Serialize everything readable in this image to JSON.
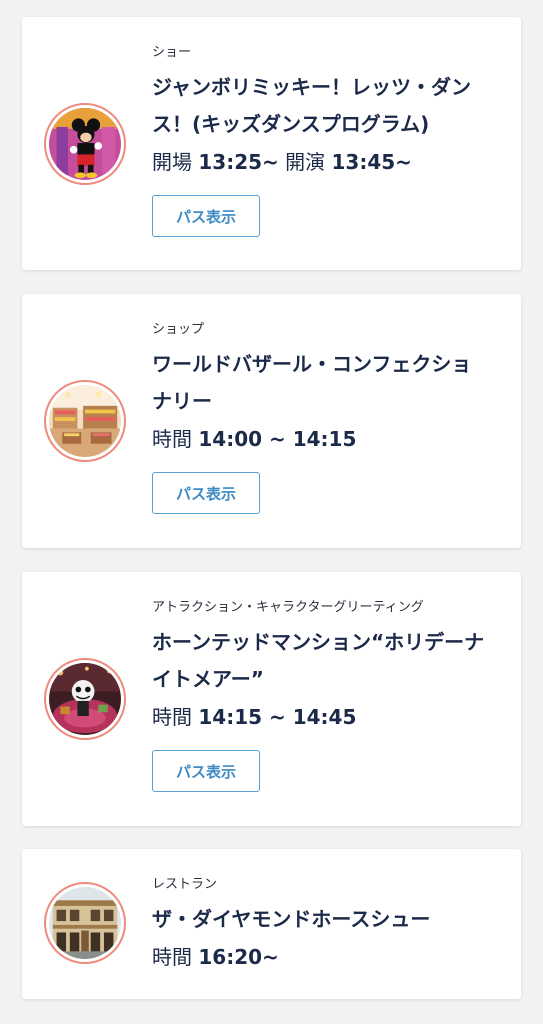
{
  "items": [
    {
      "category": "ショー",
      "title_lines": [
        "ジャンボリミッキー！レッツ・ダン",
        "ス！(キッズダンスプログラム)"
      ],
      "time_label_1": "開場",
      "time_value_1": "13:25~",
      "time_label_2": "開演",
      "time_value_2": "13:45~",
      "button": "パス表示",
      "thumb_icon": "mickey-mouse-photo"
    },
    {
      "category": "ショップ",
      "title_lines": [
        "ワールドバザール・コンフェクショ",
        "ナリー"
      ],
      "time_label_1": "時間",
      "time_value_1": "14:00 ~ 14:15",
      "button": "パス表示",
      "thumb_icon": "shop-interior-photo"
    },
    {
      "category": "アトラクション・キャラクターグリーティング",
      "title_lines": [
        "ホーンテッドマンション“ホリデーナ",
        "イトメアー”"
      ],
      "time_label_1": "時間",
      "time_value_1": "14:15 ~ 14:45",
      "button": "パス表示",
      "thumb_icon": "haunted-mansion-photo"
    },
    {
      "category": "レストラン",
      "title_lines": [
        "ザ・ダイヤモンドホースシュー"
      ],
      "time_label_1": "時間",
      "time_value_1": "16:20~",
      "thumb_icon": "restaurant-building-photo"
    }
  ],
  "colors": {
    "title": "#1c2a4a",
    "button_border": "#5a9fd1",
    "button_text": "#3d8ac4",
    "thumb_ring": "#ee8b7c"
  }
}
